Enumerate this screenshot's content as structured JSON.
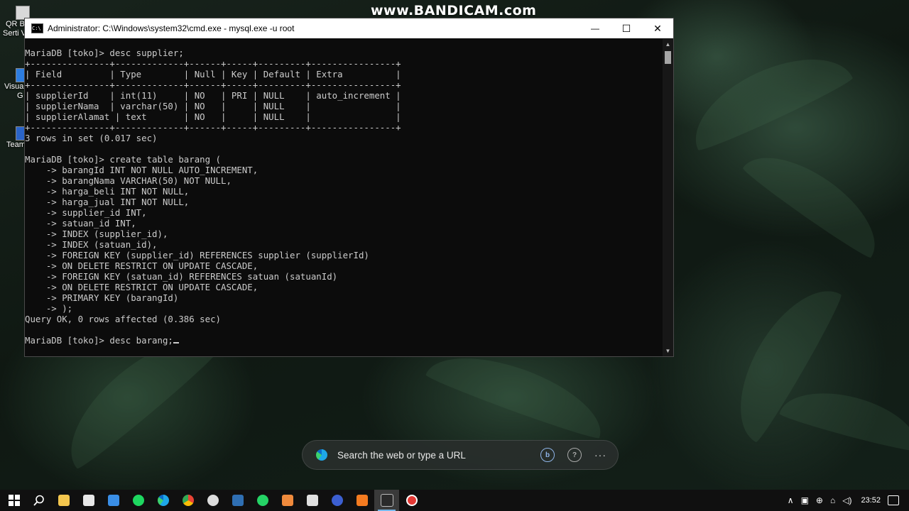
{
  "desktop": {
    "icons": [
      {
        "label_line1": "QR B",
        "label_line2": "Serti V"
      },
      {
        "label_line1": "Visual",
        "label_line2": "G"
      },
      {
        "label_line1": "Team",
        "label_line2": ""
      }
    ]
  },
  "watermark": "www.BANDICAM.com",
  "cmd_window": {
    "title": "Administrator: C:\\Windows\\system32\\cmd.exe - mysql.exe  -u root",
    "minimize_symbol": "—",
    "maximize_symbol": "☐",
    "close_symbol": "✕",
    "console_text": "MariaDB [toko]> desc supplier;\n+---------------+-------------+------+-----+---------+----------------+\n| Field         | Type        | Null | Key | Default | Extra          |\n+---------------+-------------+------+-----+---------+----------------+\n| supplierId    | int(11)     | NO   | PRI | NULL    | auto_increment |\n| supplierNama  | varchar(50) | NO   |     | NULL    |                |\n| supplierAlamat | text       | NO   |     | NULL    |                |\n+---------------+-------------+------+-----+---------+----------------+\n3 rows in set (0.017 sec)\n\nMariaDB [toko]> create table barang (\n    -> barangId INT NOT NULL AUTO_INCREMENT,\n    -> barangNama VARCHAR(50) NOT NULL,\n    -> harga_beli INT NOT NULL,\n    -> harga_jual INT NOT NULL,\n    -> supplier_id INT,\n    -> satuan_id INT,\n    -> INDEX (supplier_id),\n    -> INDEX (satuan_id),\n    -> FOREIGN KEY (supplier_id) REFERENCES supplier (supplierId)\n    -> ON DELETE RESTRICT ON UPDATE CASCADE,\n    -> FOREIGN KEY (satuan_id) REFERENCES satuan (satuanId)\n    -> ON DELETE RESTRICT ON UPDATE CASCADE,\n    -> PRIMARY KEY (barangId)\n    -> );\nQuery OK, 0 rows affected (0.386 sec)\n\nMariaDB [toko]> desc barang;"
  },
  "edge_search": {
    "placeholder": "Search the web or type a URL",
    "bing_label": "b",
    "help_label": "?",
    "more_label": "···"
  },
  "taskbar": {
    "apps": [
      {
        "name": "start",
        "color": "#ffffff"
      },
      {
        "name": "search",
        "color": "#ffffff"
      },
      {
        "name": "file-explorer",
        "color": "#f4c64e"
      },
      {
        "name": "calculator-app",
        "color": "#e8e8e8"
      },
      {
        "name": "mail",
        "color": "#3a8ee6"
      },
      {
        "name": "spotify",
        "color": "#1ed760"
      },
      {
        "name": "edge",
        "color": "#1ea7e8"
      },
      {
        "name": "chrome",
        "color": "#f2c11b"
      },
      {
        "name": "inkscape",
        "color": "#dddddd"
      },
      {
        "name": "photoshop",
        "color": "#2f6fb3"
      },
      {
        "name": "whatsapp",
        "color": "#25d366"
      },
      {
        "name": "app-orange",
        "color": "#f08a3c"
      },
      {
        "name": "notepad",
        "color": "#e0e0e0"
      },
      {
        "name": "browser-blue",
        "color": "#3c5fd1"
      },
      {
        "name": "xampp",
        "color": "#f57b20"
      },
      {
        "name": "cmd",
        "color": "#2a2a2a"
      },
      {
        "name": "bandicam-record",
        "color": "#e53935"
      }
    ],
    "tray": {
      "chevron": "∧",
      "time": "23:52"
    }
  }
}
